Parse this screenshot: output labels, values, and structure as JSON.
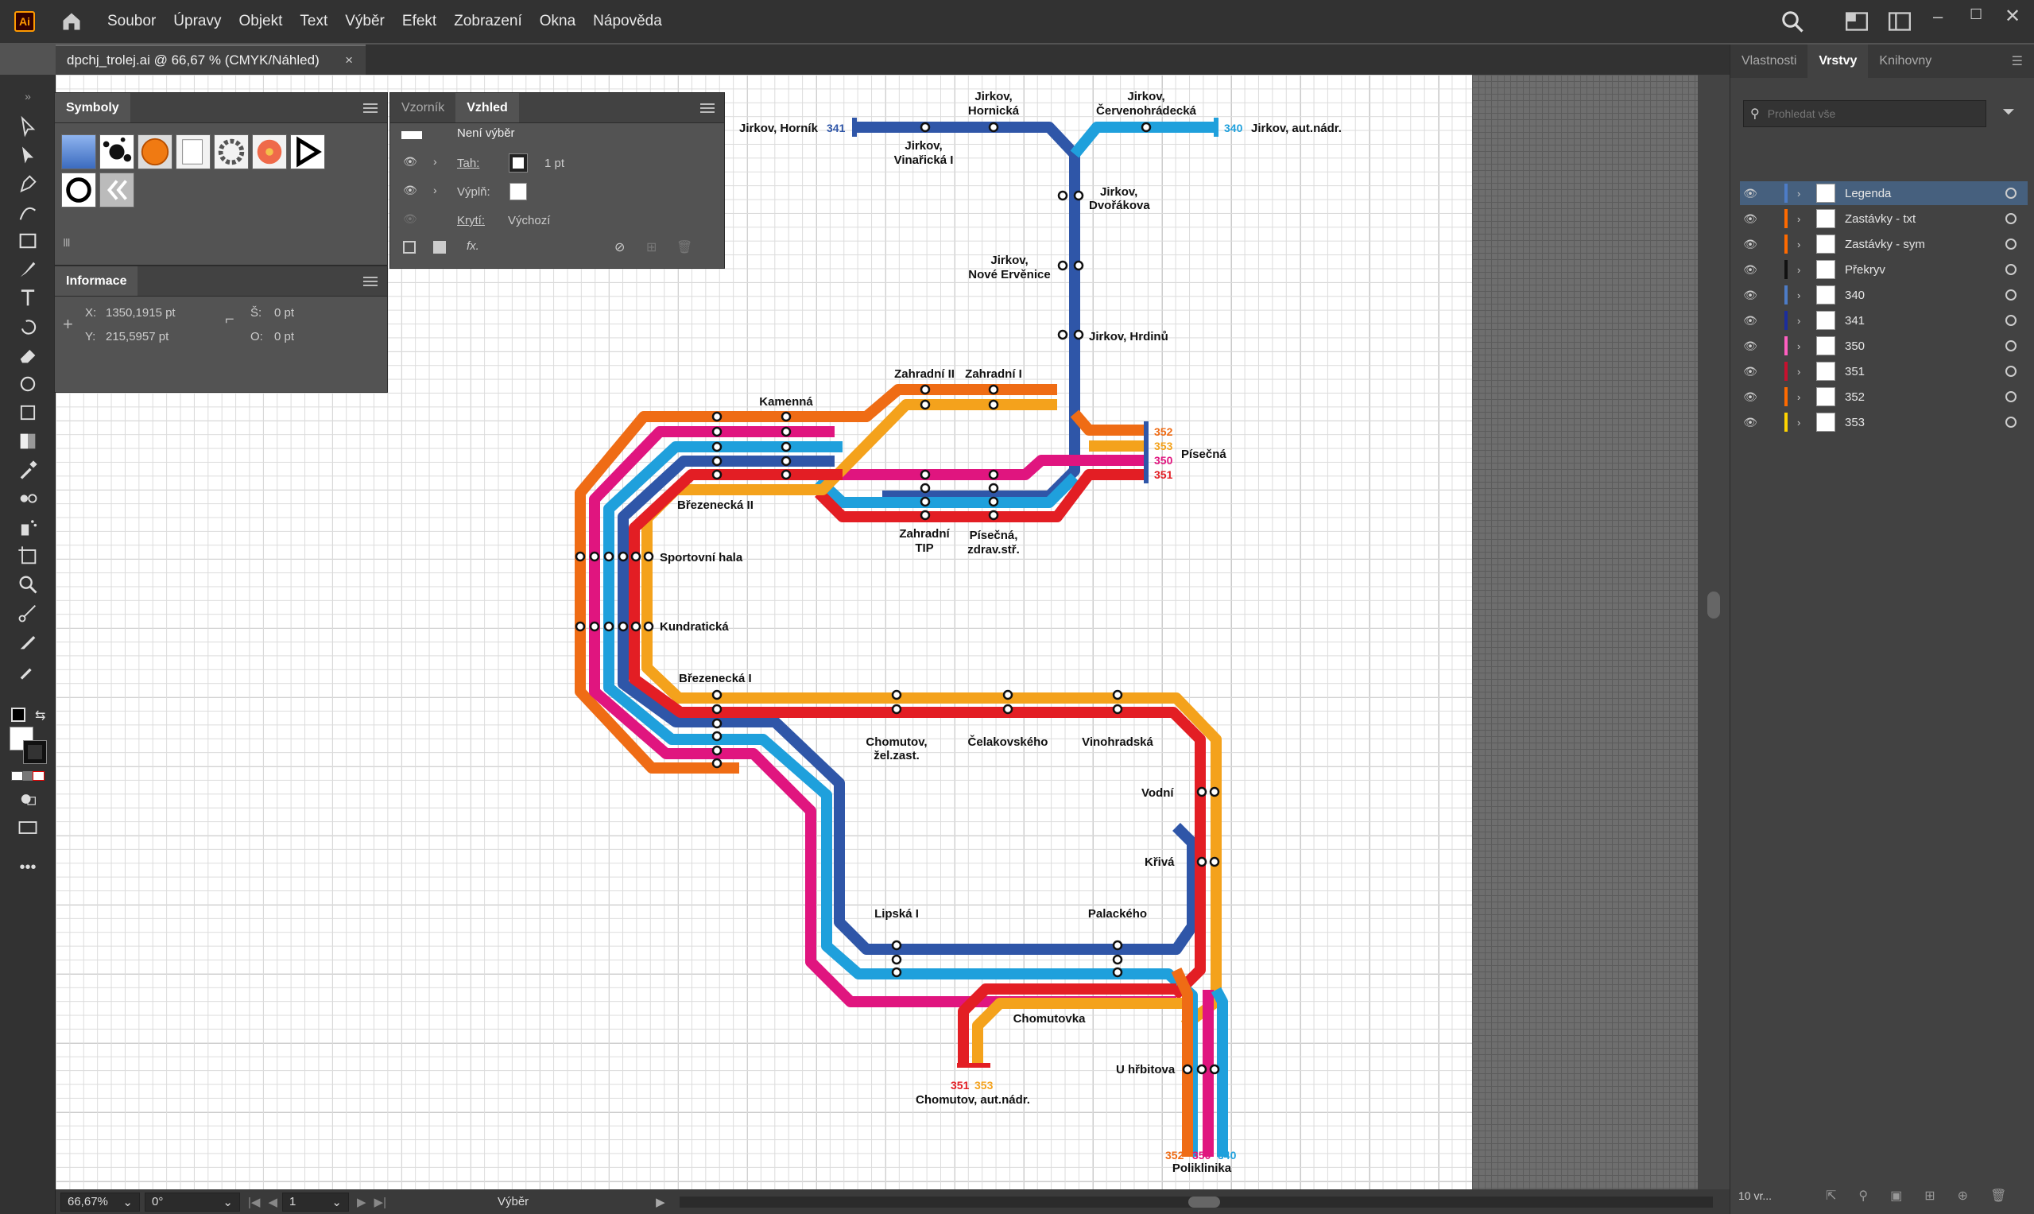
{
  "app": {
    "logo": "Ai",
    "menu": [
      "Soubor",
      "Úpravy",
      "Objekt",
      "Text",
      "Výběr",
      "Efekt",
      "Zobrazení",
      "Okna",
      "Nápověda"
    ]
  },
  "document": {
    "tab_title": "dpchj_trolej.ai @ 66,67 % (CMYK/Náhled)",
    "close": "×"
  },
  "symbols_panel": {
    "title": "Symboly"
  },
  "info_panel": {
    "title": "Informace",
    "x_label": "X:",
    "x_value": "1350,1915 pt",
    "y_label": "Y:",
    "y_value": "215,5957 pt",
    "w_label": "Š:",
    "w_value": "0 pt",
    "h_label": "O:",
    "h_value": "0 pt"
  },
  "appearance_panel": {
    "tabs": [
      "Vzorník",
      "Vzhled"
    ],
    "no_selection": "Není výběr",
    "stroke_label": "Tah:",
    "stroke_value": "1 pt",
    "fill_label": "Výplň:",
    "opacity_label": "Krytí:",
    "opacity_value": "Výchozí",
    "fx": "fx."
  },
  "right_panel": {
    "tabs": [
      "Vlastnosti",
      "Vrstvy",
      "Knihovny"
    ],
    "search_placeholder": "Prohledat vše",
    "layers": [
      {
        "name": "Legenda",
        "color": "#4d7cc7"
      },
      {
        "name": "Zastávky - txt",
        "color": "#ff6a00"
      },
      {
        "name": "Zastávky - sym",
        "color": "#ff6a00"
      },
      {
        "name": "Překryv",
        "color": "#111111"
      },
      {
        "name": "340",
        "color": "#4d7cc7"
      },
      {
        "name": "341",
        "color": "#1c2d9c"
      },
      {
        "name": "350",
        "color": "#ff5fc1"
      },
      {
        "name": "351",
        "color": "#c8102e"
      },
      {
        "name": "352",
        "color": "#ff6a00"
      },
      {
        "name": "353",
        "color": "#ffd400"
      }
    ],
    "footer": "10 vr..."
  },
  "status": {
    "zoom": "66,67%",
    "rotation": "0°",
    "artboard": "1",
    "mode": "Výběr"
  },
  "map": {
    "colors": {
      "c340": "#1fa0dc",
      "c341": "#2f56a8",
      "c350": "#e0157f",
      "c351": "#e31e24",
      "c352": "#ef6c15",
      "c353": "#f4a21c"
    },
    "stops": {
      "horni": "Jirkov, Horník",
      "hornicka1": "Jirkov,",
      "hornicka2": "Hornická",
      "cerv1": "Jirkov,",
      "cerv2": "Červenohrádecká",
      "autnadr": "Jirkov, aut.nádr.",
      "vin1": "Jirkov,",
      "vin2": "Vinařická I",
      "dvor1": "Jirkov,",
      "dvor2": "Dvořákova",
      "erv1": "Jirkov,",
      "erv2": "Nové Ervěnice",
      "hrdinu": "Jirkov, Hrdinů",
      "zahr2": "Zahradní II",
      "zahr1": "Zahradní I",
      "kamenna": "Kamenná",
      "pisecna": "Písečná",
      "brez2": "Březenecká II",
      "ztip1": "Zahradní",
      "ztip2": "TIP",
      "pz1": "Písečná,",
      "pz2": "zdrav.stř.",
      "sport": "Sportovní hala",
      "kundr": "Kundratická",
      "brez1": "Březenecká I",
      "chz1": "Chomutov,",
      "chz2": "žel.zast.",
      "celak": "Čelakovského",
      "vinoh": "Vinohradská",
      "vodni": "Vodní",
      "kriva": "Křivá",
      "lipska": "Lipská I",
      "palac": "Palackého",
      "chomutovka": "Chomutovka",
      "hrbitov": "U hřbitova",
      "chan": "Chomutov, aut.nádr.",
      "poli": "Poliklinika"
    },
    "line_labels": {
      "l340": "340",
      "l341": "341",
      "l350": "350",
      "l351": "351",
      "l352": "352",
      "l353": "353"
    }
  }
}
